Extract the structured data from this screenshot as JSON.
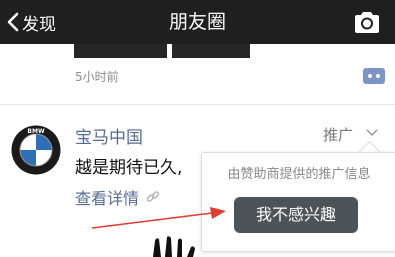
{
  "nav": {
    "back_label": "发现",
    "title": "朋友圈"
  },
  "previous_post": {
    "time": "5小时前"
  },
  "ad_post": {
    "author": "宝马中国",
    "avatar_text": "BMW",
    "ad_label": "推广",
    "text": "越是期待已久,",
    "detail_link": "查看详情"
  },
  "popover": {
    "info": "由赞助商提供的推广信息",
    "dislike_button": "我不感兴趣"
  },
  "colors": {
    "navbar": "#1f1f1f",
    "link_blue": "#576b95",
    "annotation_arrow": "#e03c31",
    "button_dark": "#4d5357"
  }
}
